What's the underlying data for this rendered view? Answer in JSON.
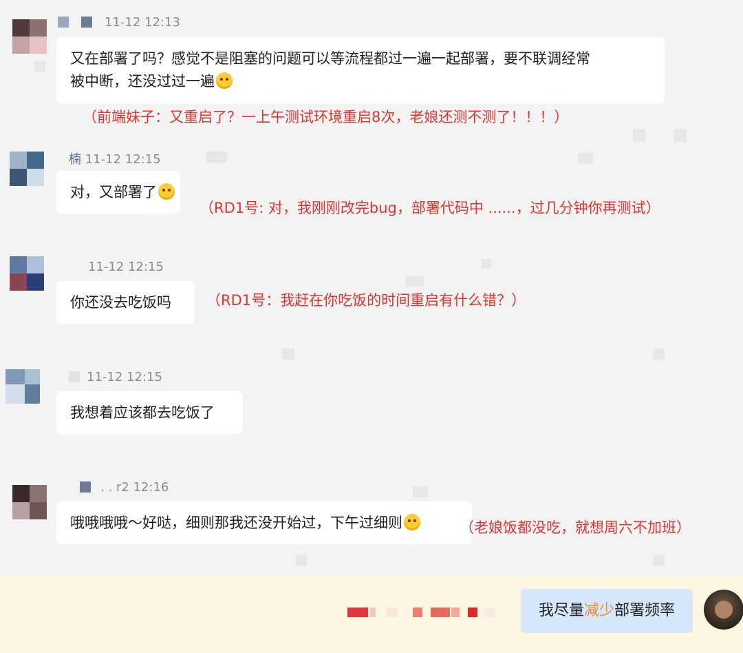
{
  "messages": [
    {
      "sender": "",
      "time": "11-12 12:13",
      "text_line1": "又在部署了吗？感觉不是阻塞的问题可以等流程都过一遍一起部署，要不联调经常",
      "text_line2": "被中断，还没过过一遍",
      "emoji": "sweat-emoji",
      "annotation": "（前端妹子：又重启了？一上午测试环境重启8次，老娘还测不测了！！！）"
    },
    {
      "sender": "楠",
      "time": "11-12 12:15",
      "text": "对，又部署了",
      "emoji": "tears-of-joy-emoji",
      "annotation": "（RD1号: 对，我刚刚改完bug，部署代码中 ......，过几分钟你再测试）"
    },
    {
      "sender": "",
      "time": "11-12 12:15",
      "text": "你还没去吃饭吗",
      "annotation": "（RD1号：我赶在你吃饭的时间重启有什么错？）"
    },
    {
      "sender": "",
      "time": "11-12 12:15",
      "text": "我想着应该都去吃饭了"
    },
    {
      "sender": ". .  r2",
      "time": "12:16",
      "text": "哦哦哦哦～好哒，细则那我还没开始过，下午过细则",
      "emoji": "grin-emoji",
      "annotation": "（老娘饭都没吃，就想周六不加班）"
    }
  ],
  "my_message": {
    "before": "我尽量",
    "highlight": "减少",
    "after": "部署频率"
  },
  "colors": {
    "annotation": "#e4332f",
    "my_bubble": "#d6e6fb",
    "highlight": "#ef8a2f",
    "footer": "#fdf6e3"
  }
}
